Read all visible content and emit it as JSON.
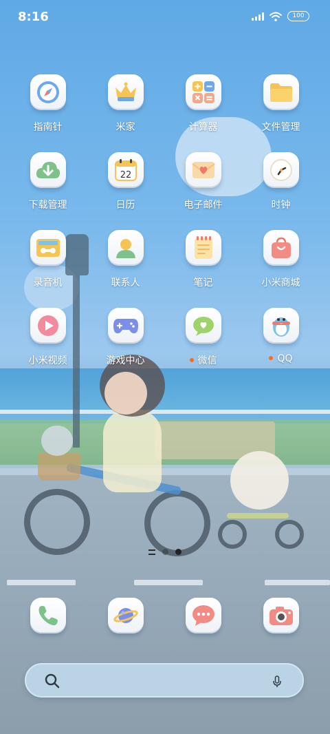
{
  "status_bar": {
    "time": "8:16",
    "battery": "100"
  },
  "apps": [
    {
      "label": "指南针",
      "icon": "compass-icon"
    },
    {
      "label": "米家",
      "icon": "crown-home-icon"
    },
    {
      "label": "计算器",
      "icon": "calculator-icon"
    },
    {
      "label": "文件管理",
      "icon": "folder-icon"
    },
    {
      "label": "下载管理",
      "icon": "download-cloud-icon"
    },
    {
      "label": "日历",
      "icon": "calendar-icon",
      "day": "22"
    },
    {
      "label": "电子邮件",
      "icon": "mail-heart-icon"
    },
    {
      "label": "时钟",
      "icon": "clock-icon"
    },
    {
      "label": "录音机",
      "icon": "recorder-icon"
    },
    {
      "label": "联系人",
      "icon": "contact-icon"
    },
    {
      "label": "笔记",
      "icon": "notes-icon"
    },
    {
      "label": "小米商城",
      "icon": "shopping-bag-icon"
    },
    {
      "label": "小米视频",
      "icon": "play-video-icon"
    },
    {
      "label": "游戏中心",
      "icon": "gamepad-icon"
    },
    {
      "label": "微信",
      "icon": "wechat-icon",
      "new": true
    },
    {
      "label": "QQ",
      "icon": "qq-penguin-icon",
      "new": true
    }
  ],
  "dock": [
    {
      "name": "phone",
      "icon": "phone-icon"
    },
    {
      "name": "browser",
      "icon": "planet-icon"
    },
    {
      "name": "messages",
      "icon": "chat-bubble-icon"
    },
    {
      "name": "camera",
      "icon": "camera-icon"
    }
  ],
  "page_indicator": {
    "pages": 2,
    "current": 2
  },
  "search": {
    "icons": [
      "search-icon",
      "microphone-icon"
    ]
  },
  "colors": {
    "accent_dot": "#ff6a1a",
    "sky": "#6fb1e8",
    "icon_tile": "#ffffff"
  }
}
